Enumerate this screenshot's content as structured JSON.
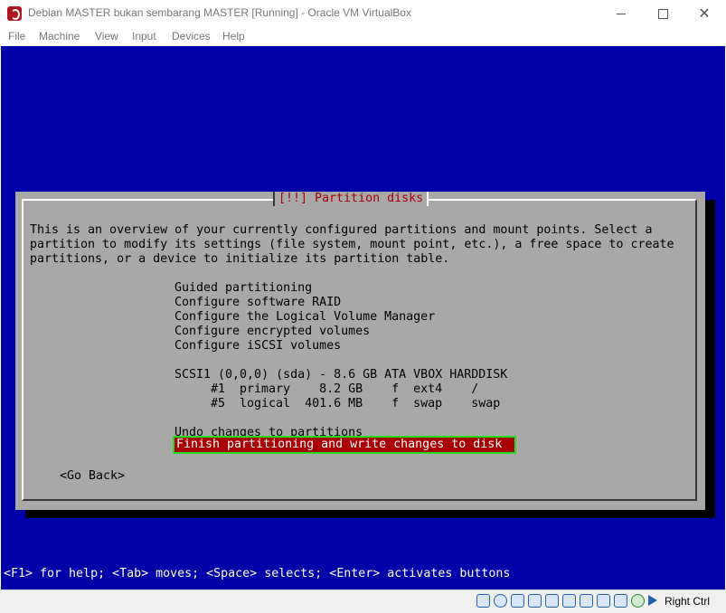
{
  "window": {
    "title": "Debian MASTER bukan sembarang MASTER [Running] - Oracle VM VirtualBox",
    "minimize_glyph": "",
    "close_glyph": "✕"
  },
  "menu": [
    "File",
    "Machine",
    "View",
    "Input",
    "Devices",
    "Help"
  ],
  "dialog": {
    "title": "[!!] Partition disks",
    "intro": [
      "This is an overview of your currently configured partitions and mount points. Select a",
      "partition to modify its settings (file system, mount point, etc.), a free space to create",
      "partitions, or a device to initialize its partition table."
    ],
    "options": [
      "Guided partitioning",
      "Configure software RAID",
      "Configure the Logical Volume Manager",
      "Configure encrypted volumes",
      "Configure iSCSI volumes"
    ],
    "disk": "SCSI1 (0,0,0) (sda) - 8.6 GB ATA VBOX HARDDISK",
    "partitions": [
      "#1  primary    8.2 GB    f  ext4    /",
      "#5  logical  401.6 MB    f  swap    swap"
    ],
    "undo": "Undo changes to partitions",
    "finish": "Finish partitioning and write changes to disk",
    "go_back": "<Go Back>"
  },
  "help_line": "<F1> for help; <Tab> moves; <Space> selects; <Enter> activates buttons",
  "statusbar": {
    "icons": [
      "hard-disk-icon",
      "optical-drive-icon",
      "audio-icon",
      "network-icon",
      "usb-icon",
      "shared-folder-icon",
      "display-icon",
      "video-capture-icon",
      "cpu-icon",
      "mouse-integration-icon",
      "keyboard-icon"
    ],
    "host_key": "Right Ctrl"
  },
  "colors": {
    "screen_bg": "#0000a8",
    "dialog_bg": "#a8a8a8",
    "title_red": "#a80000",
    "selection_bg": "#a80000",
    "highlight_outline": "#22dd22"
  }
}
